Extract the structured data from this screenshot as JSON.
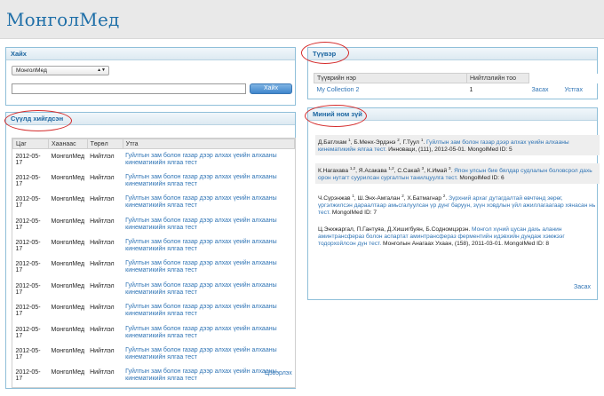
{
  "app": {
    "title": "МонголМед"
  },
  "search": {
    "title": "Хайх",
    "select_value": "МонголМед",
    "button_label": "Хайх"
  },
  "history": {
    "title": "Сүүлд хийгдсэн",
    "columns": [
      "Цаг",
      "Хаанаас",
      "Төрөл",
      "Утга"
    ],
    "rows": [
      {
        "date": "2012-05-17",
        "source": "МонголМед",
        "type": "Нийтлэл",
        "title": "Гуйлтын зам болон газар дээр алхах үеийн алхааны кинематикийн ялгаа тест"
      },
      {
        "date": "2012-05-17",
        "source": "МонголМед",
        "type": "Нийтлэл",
        "title": "Гуйлтын зам болон газар дээр алхах үеийн алхааны кинематикийн ялгаа тест"
      },
      {
        "date": "2012-05-17",
        "source": "МонголМед",
        "type": "Нийтлэл",
        "title": "Гуйлтын зам болон газар дээр алхах үеийн алхааны кинематикийн ялгаа тест"
      },
      {
        "date": "2012-05-17",
        "source": "МонголМед",
        "type": "Нийтлэл",
        "title": "Гуйлтын зам болон газар дээр алхах үеийн алхааны кинематикийн ялгаа тест"
      },
      {
        "date": "2012-05-17",
        "source": "МонголМед",
        "type": "Нийтлэл",
        "title": "Гуйлтын зам болон газар дээр алхах үеийн алхааны кинематикийн ялгаа тест"
      },
      {
        "date": "2012-05-17",
        "source": "МонголМед",
        "type": "Нийтлэл",
        "title": "Гуйлтын зам болон газар дээр алхах үеийн алхааны кинематикийн ялгаа тест"
      },
      {
        "date": "2012-05-17",
        "source": "МонголМед",
        "type": "Нийтлэл",
        "title": "Гуйлтын зам болон газар дээр алхах үеийн алхааны кинематикийн ялгаа тест"
      },
      {
        "date": "2012-05-17",
        "source": "МонголМед",
        "type": "Нийтлэл",
        "title": "Гуйлтын зам болон газар дээр алхах үеийн алхааны кинематикийн ялгаа тест"
      },
      {
        "date": "2012-05-17",
        "source": "МонголМед",
        "type": "Нийтлэл",
        "title": "Гуйлтын зам болон газар дээр алхах үеийн алхааны кинематикийн ялгаа тест"
      },
      {
        "date": "2012-05-17",
        "source": "МонголМед",
        "type": "Нийтлэл",
        "title": "Гуйлтын зам болон газар дээр алхах үеийн алхааны кинематикийн ялгаа тест"
      },
      {
        "date": "2012-05-17",
        "source": "МонголМед",
        "type": "Нийтлэл",
        "title": "Гуйлтын зам болон газар дээр алхах үеийн алхааны кинематикийн ялгаа тест"
      }
    ],
    "clear_label": "Цэвэрлэх"
  },
  "collections": {
    "title": "Түүвэр",
    "columns": [
      "Түүврийн нэр",
      "Нийтлэлийн тоо"
    ],
    "rows": [
      {
        "name": "My Collection 2",
        "count": "1",
        "edit": "Засах",
        "delete": "Устгах"
      }
    ]
  },
  "bibliography": {
    "title": "Миний ном зүй",
    "edit_label": "Засах",
    "items": [
      {
        "authors": [
          [
            "Д.Батлхам",
            "1"
          ],
          [
            "Б.Менх-Эрдэнэ",
            "2"
          ],
          [
            "Г.Туул",
            "1"
          ]
        ],
        "title": "Гуйлтын зам болон газар дээр алхах үеийн алхааны кинематикийн ялгаа тест.",
        "journal": "Инноваци, (111), 2012-05-01.",
        "mid": "MongolMed ID: 5"
      },
      {
        "authors": [
          [
            "К.Нагахава",
            "1,2"
          ],
          [
            "Я.Асакава",
            "1,2"
          ],
          [
            "С.Сакай",
            "3"
          ],
          [
            "К.Имай",
            "3"
          ]
        ],
        "title": "Япон улсын бие бялдар судлалын боловсрол дахь орон нутагт суурилсан сургалтын танилцуулга тест.",
        "journal": "",
        "mid": "MongolMed ID: 6"
      },
      {
        "authors": [
          [
            "Ч.Сүрэнжав",
            "1"
          ],
          [
            "Ш.Энх-Амгалан",
            "2"
          ],
          [
            "Х.Батмагнар",
            "2"
          ]
        ],
        "title": "Зүрхний архаг дутагдалтай өвчтөнд зөрөг, үргэлжилсэн дараалтаар амьсгалуулсан үр дүнг баруун, зүүн ховдлын үйл ажиллагаагаар хянасан нь тест.",
        "journal": "",
        "mid": "MongolMed ID: 7"
      },
      {
        "authors": [
          [
            "Ц.Энхжаргал",
            ""
          ],
          [
            "П.Гантуяа",
            ""
          ],
          [
            "Д.Хишигбуян",
            ""
          ],
          [
            "Б.Содномцэрэн",
            ""
          ]
        ],
        "title": "Монгол хүний цусан дахь аланин аминтрансфераз болон аспартат аминтрансфераз ферментийн идэвхийн дундаж хэмжээг тодорхойлсон дүн тест.",
        "journal": "Монголын Анагаах Ухаан, (158), 2011-03-01.",
        "mid": "MongolMed ID: 8"
      }
    ]
  }
}
